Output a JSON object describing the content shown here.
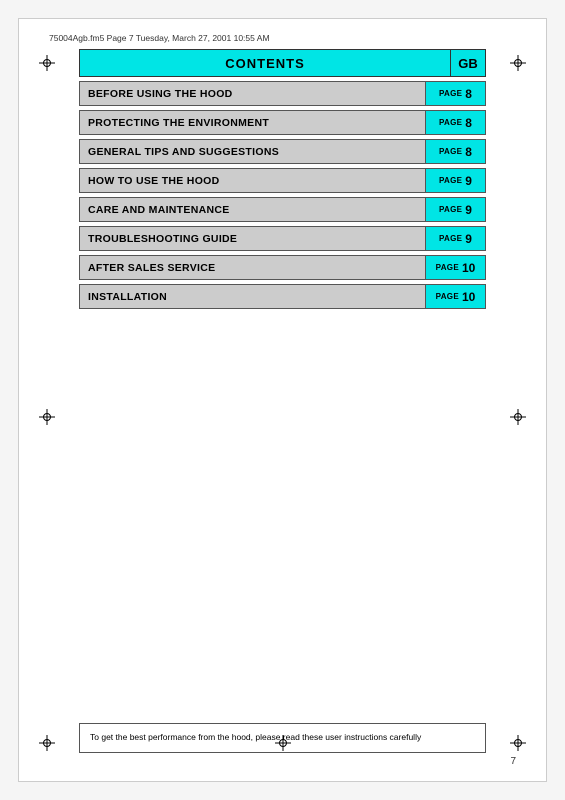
{
  "header": {
    "file_info": "75004Agb.fm5  Page 7  Tuesday, March 27, 2001  10:55 AM"
  },
  "contents": {
    "title": "CONTENTS",
    "gb_label": "GB"
  },
  "toc": {
    "items": [
      {
        "label": "BEFORE USING THE HOOD",
        "page_word": "PAGE",
        "page_num": "8"
      },
      {
        "label": "PROTECTING THE ENVIRONMENT",
        "page_word": "PAGE",
        "page_num": "8"
      },
      {
        "label": "GENERAL TIPS AND SUGGESTIONS",
        "page_word": "PAGE",
        "page_num": "8"
      },
      {
        "label": "HOW TO USE THE HOOD",
        "page_word": "PAGE",
        "page_num": "9"
      },
      {
        "label": "CARE AND MAINTENANCE",
        "page_word": "PAGE",
        "page_num": "9"
      },
      {
        "label": "TROUBLESHOOTING GUIDE",
        "page_word": "PAGE",
        "page_num": "9"
      },
      {
        "label": "AFTER SALES SERVICE",
        "page_word": "PAGE",
        "page_num": "10"
      },
      {
        "label": "INSTALLATION",
        "page_word": "PAGE",
        "page_num": "10"
      }
    ]
  },
  "bottom_note": {
    "text": "To get the best performance from the hood, please read these user instructions carefully"
  },
  "page_number": "7",
  "colors": {
    "cyan": "#00e5e5",
    "gray_row": "#cccccc",
    "border": "#555555"
  }
}
